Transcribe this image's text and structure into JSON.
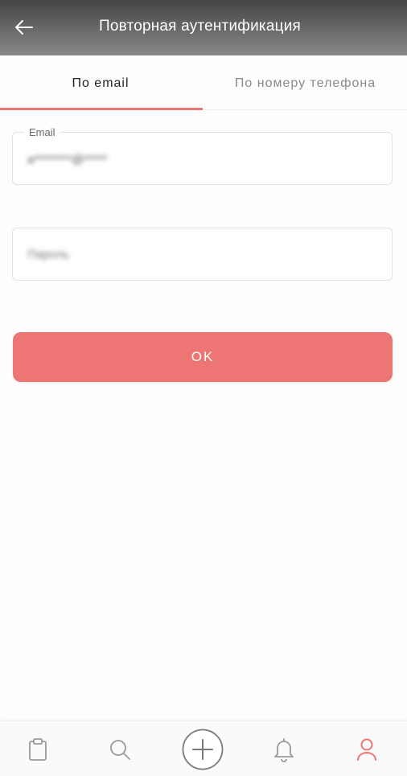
{
  "app_bar": {
    "title": "Повторная аутентификация",
    "back_icon": "arrow-left-icon"
  },
  "tabs": [
    {
      "label": "По email",
      "active": true
    },
    {
      "label": "По номеру телефона",
      "active": false
    }
  ],
  "form": {
    "email": {
      "label": "Email",
      "value": "a********@*****"
    },
    "password": {
      "placeholder": "Пароль"
    },
    "submit_label": "OK"
  },
  "bottom_nav": {
    "items": [
      {
        "icon": "clipboard-icon",
        "active": false
      },
      {
        "icon": "search-icon",
        "active": false
      },
      {
        "icon": "add-circle-icon",
        "active": false
      },
      {
        "icon": "bell-icon",
        "active": false
      },
      {
        "icon": "user-icon",
        "active": true
      }
    ]
  },
  "colors": {
    "accent": "#ee7674",
    "app_bar": "#5a5a5a",
    "inactive_icon": "#9a9a9a"
  }
}
